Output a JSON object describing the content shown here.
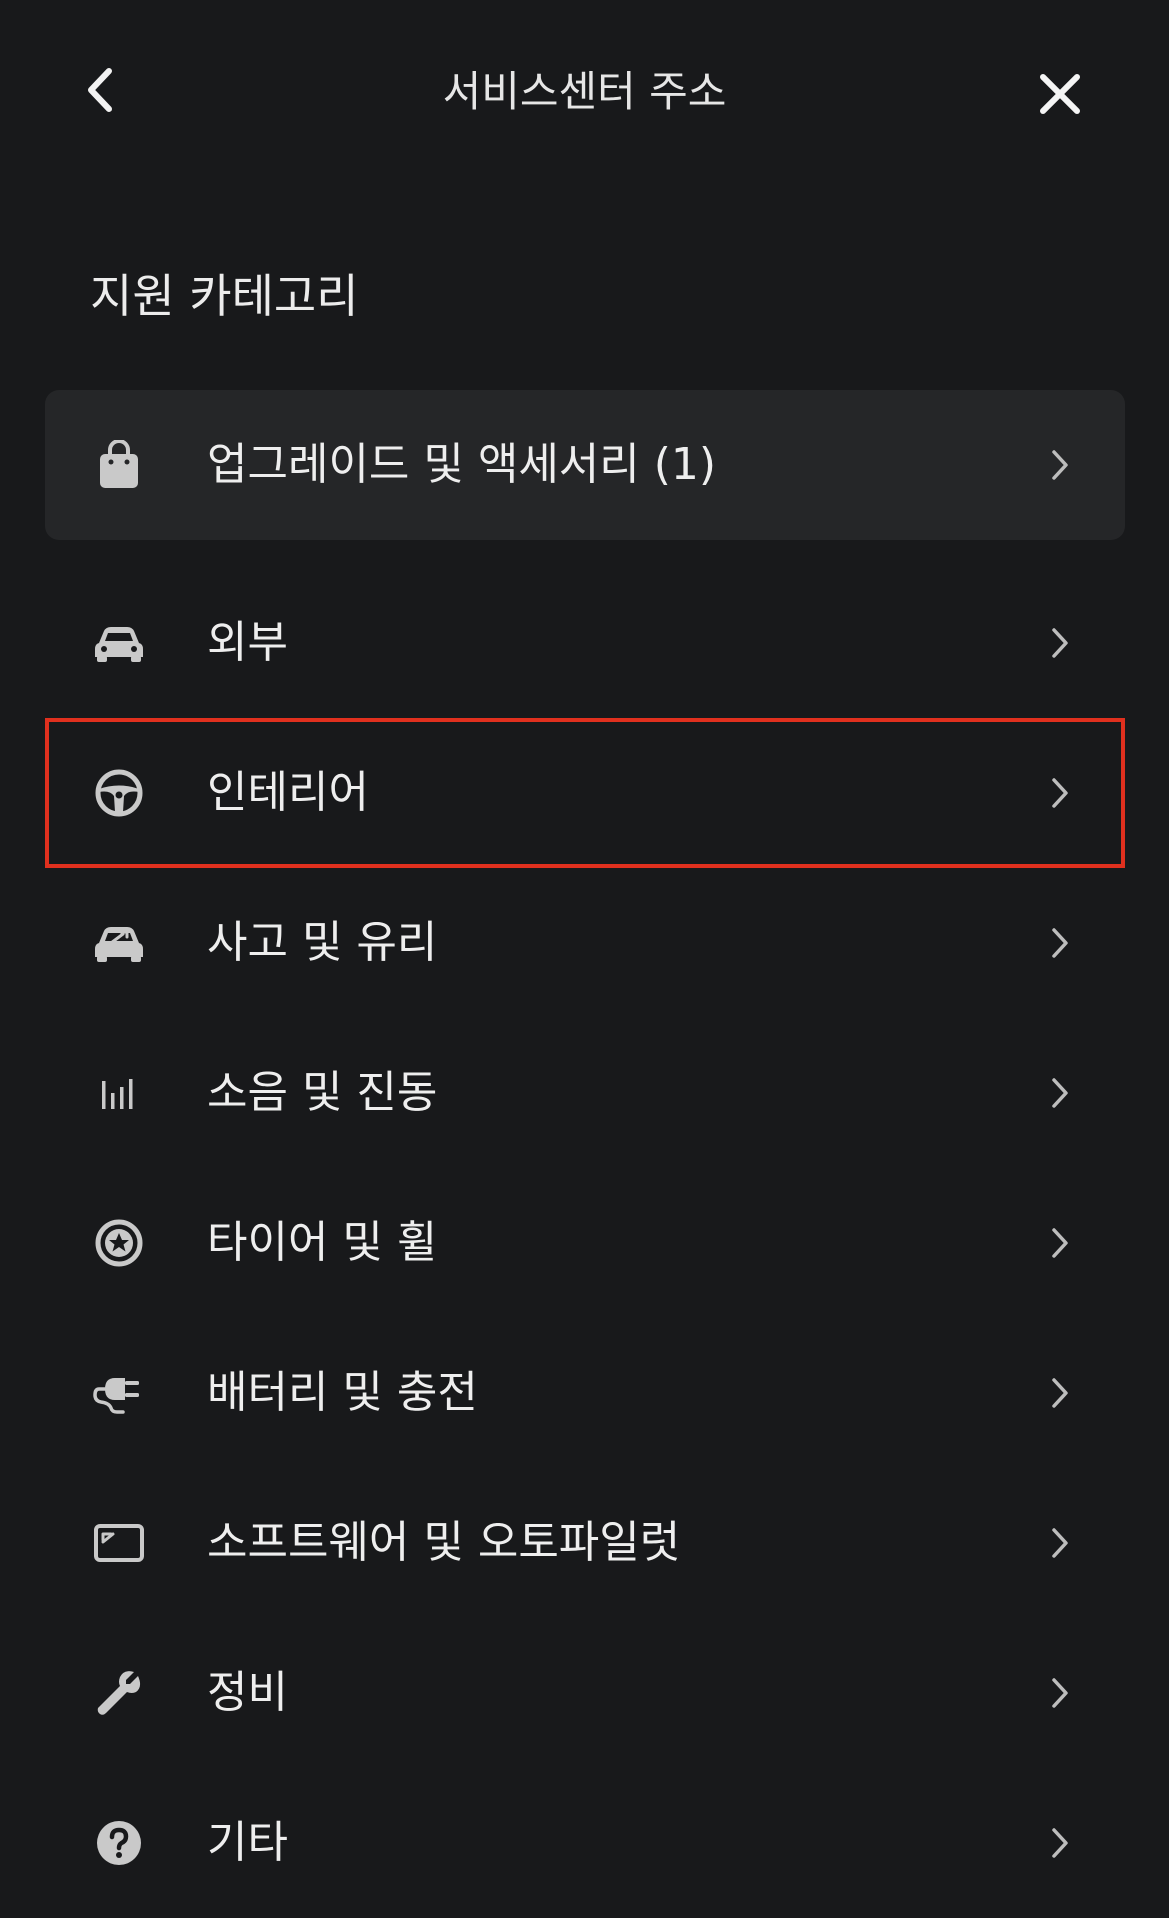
{
  "header": {
    "title": "서비스센터 주소",
    "back_icon": "chevron-left-icon",
    "close_icon": "close-icon"
  },
  "section": {
    "title": "지원 카테고리"
  },
  "colors": {
    "background": "#18191b",
    "highlight_card": "#252628",
    "selection_outline": "#e0301e",
    "text": "#eeeeee",
    "icon": "#c9c9c9"
  },
  "categories": [
    {
      "label": "업그레이드 및 액세서리 (1)",
      "icon": "shopping-bag-icon"
    },
    {
      "label": "외부",
      "icon": "car-icon"
    },
    {
      "label": "인테리어",
      "icon": "steering-wheel-icon"
    },
    {
      "label": "사고 및 유리",
      "icon": "car-repair-icon"
    },
    {
      "label": "소음 및 진동",
      "icon": "sound-bars-icon"
    },
    {
      "label": "타이어 및 휠",
      "icon": "wheel-icon"
    },
    {
      "label": "배터리 및 충전",
      "icon": "charging-plug-icon"
    },
    {
      "label": "소프트웨어 및 오토파일럿",
      "icon": "screen-icon"
    },
    {
      "label": "정비",
      "icon": "wrench-icon"
    },
    {
      "label": "기타",
      "icon": "question-icon"
    }
  ]
}
